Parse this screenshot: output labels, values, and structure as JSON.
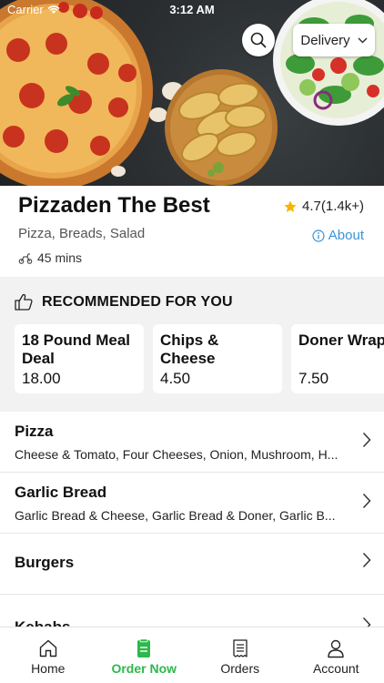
{
  "status_bar": {
    "carrier": "Carrier",
    "time": "3:12 AM"
  },
  "header": {
    "search_icon": "search-icon",
    "delivery_label": "Delivery"
  },
  "restaurant": {
    "name": "Pizzaden The Best",
    "rating": "4.7(1.4k+)",
    "cuisine": "Pizza, Breads, Salad",
    "about_label": "About",
    "eta": "45 mins"
  },
  "recommended": {
    "title": "RECOMMENDED FOR YOU",
    "items": [
      {
        "name": "18 Pound Meal Deal",
        "price": "18.00"
      },
      {
        "name": "Chips & Cheese",
        "price": "4.50"
      },
      {
        "name": "Doner Wrap",
        "price": "7.50"
      }
    ]
  },
  "categories": [
    {
      "title": "Pizza",
      "desc": "Cheese & Tomato, Four Cheeses, Onion, Mushroom, H..."
    },
    {
      "title": "Garlic Bread",
      "desc": "Garlic Bread & Cheese, Garlic Bread & Doner, Garlic B..."
    },
    {
      "title": "Burgers",
      "desc": ""
    },
    {
      "title": "Kebabs",
      "desc": ""
    }
  ],
  "tabs": [
    {
      "label": "Home",
      "icon": "home-icon"
    },
    {
      "label": "Order Now",
      "icon": "order-icon"
    },
    {
      "label": "Orders",
      "icon": "receipt-icon"
    },
    {
      "label": "Account",
      "icon": "account-icon"
    }
  ],
  "colors": {
    "accent_green": "#2db84b",
    "link_blue": "#3a94d6",
    "star": "#f5b400"
  }
}
